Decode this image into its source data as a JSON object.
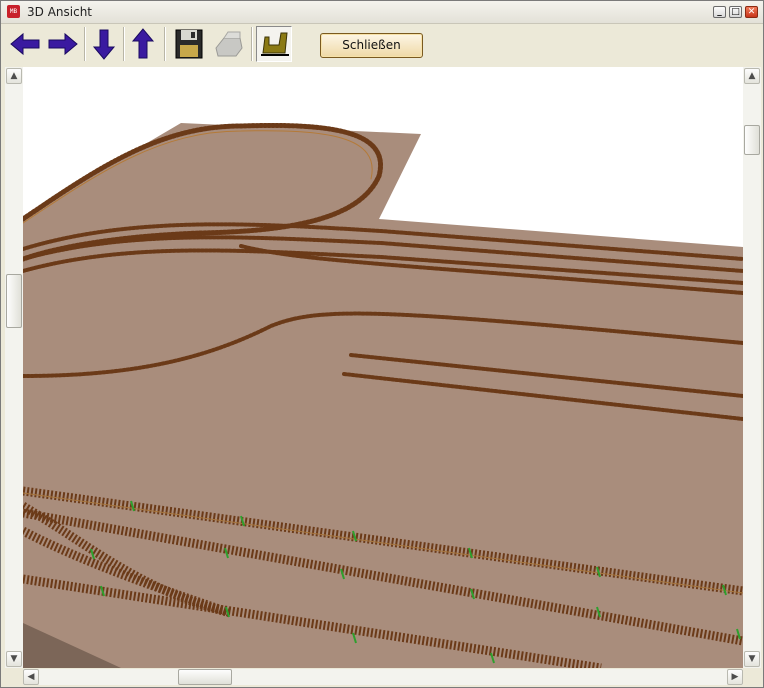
{
  "window": {
    "title": "3D Ansicht",
    "app_icon_text": "MB"
  },
  "title_buttons": {
    "minimize": "_",
    "maximize": "□",
    "close": "✕"
  },
  "toolbar": {
    "buttons": [
      {
        "name": "arrow-left-icon"
      },
      {
        "name": "arrow-right-icon"
      },
      {
        "name": "arrow-down-icon"
      },
      {
        "name": "arrow-up-icon"
      },
      {
        "name": "floppy-save-icon"
      },
      {
        "name": "print-icon",
        "disabled": true
      },
      {
        "name": "track-view-icon",
        "pressed": true
      }
    ],
    "close_label": "Schließen"
  },
  "scroll": {
    "up": "▲",
    "down": "▼",
    "left": "◀",
    "right": "▶"
  },
  "colors": {
    "layout_board": "#a98d7c",
    "board_edge": "#7c6658",
    "track_rail": "#8a5528",
    "sleeper_accent": "#2ea02e",
    "accent_arrows": "#3a1aa0",
    "close_button_border": "#7a5a20"
  }
}
